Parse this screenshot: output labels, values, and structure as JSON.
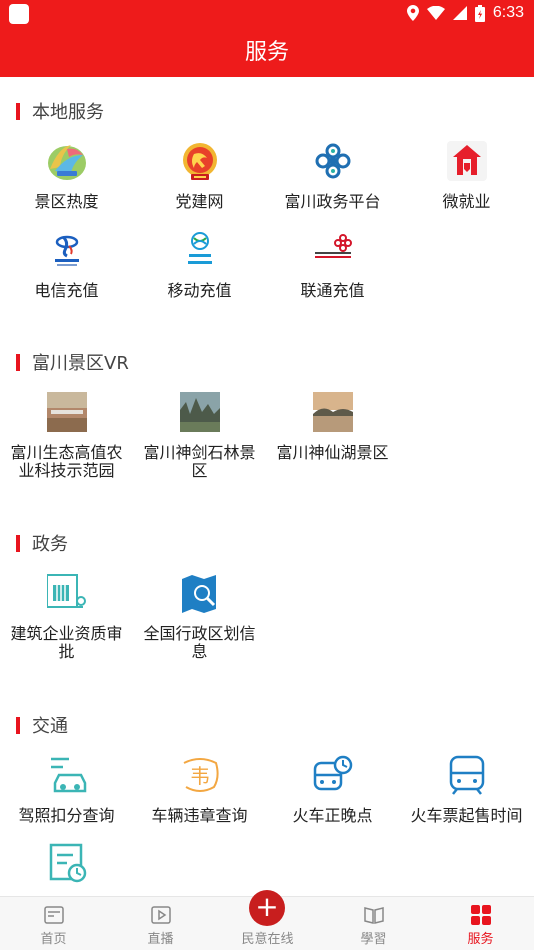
{
  "status": {
    "time": "6:33"
  },
  "header": {
    "title": "服务"
  },
  "sections": [
    {
      "title": "本地服务",
      "items": [
        {
          "label": "景区热度",
          "icon": "scenic-heat-icon"
        },
        {
          "label": "党建网",
          "icon": "party-building-icon"
        },
        {
          "label": "富川政务平台",
          "icon": "government-platform-icon"
        },
        {
          "label": "微就业",
          "icon": "micro-employment-icon"
        },
        {
          "label": "电信充值",
          "icon": "china-telecom-icon"
        },
        {
          "label": "移动充值",
          "icon": "china-mobile-icon"
        },
        {
          "label": "联通充值",
          "icon": "china-unicom-icon"
        }
      ]
    },
    {
      "title": "富川景区VR",
      "items": [
        {
          "label": "富川生态高值农业科技示范园",
          "icon": "eco-park-photo"
        },
        {
          "label": "富川神剑石林景区",
          "icon": "stone-forest-photo"
        },
        {
          "label": "富川神仙湖景区",
          "icon": "immortal-lake-photo"
        }
      ]
    },
    {
      "title": "政务",
      "items": [
        {
          "label": "建筑企业资质审批",
          "icon": "building-icon"
        },
        {
          "label": "全国行政区划信息",
          "icon": "map-search-icon"
        }
      ]
    },
    {
      "title": "交通",
      "items": [
        {
          "label": "驾照扣分查询",
          "icon": "car-license-icon"
        },
        {
          "label": "车辆违章查询",
          "icon": "violation-icon"
        },
        {
          "label": "火车正晚点",
          "icon": "train-clock-icon"
        },
        {
          "label": "火车票起售时间",
          "icon": "train-icon"
        },
        {
          "label": "",
          "icon": "ticket-clock-icon"
        }
      ]
    }
  ],
  "tabs": [
    {
      "label": "首页",
      "icon": "home-icon"
    },
    {
      "label": "直播",
      "icon": "live-icon"
    },
    {
      "label": "民意在线",
      "icon": "plus-icon"
    },
    {
      "label": "學習",
      "icon": "book-icon"
    },
    {
      "label": "服务",
      "icon": "grid-icon"
    }
  ],
  "colors": {
    "brand": "#ee1b1b",
    "accent_teal": "#3bb5b5",
    "icon_blue": "#1f7fc4",
    "tab_active": "#e8141e"
  }
}
